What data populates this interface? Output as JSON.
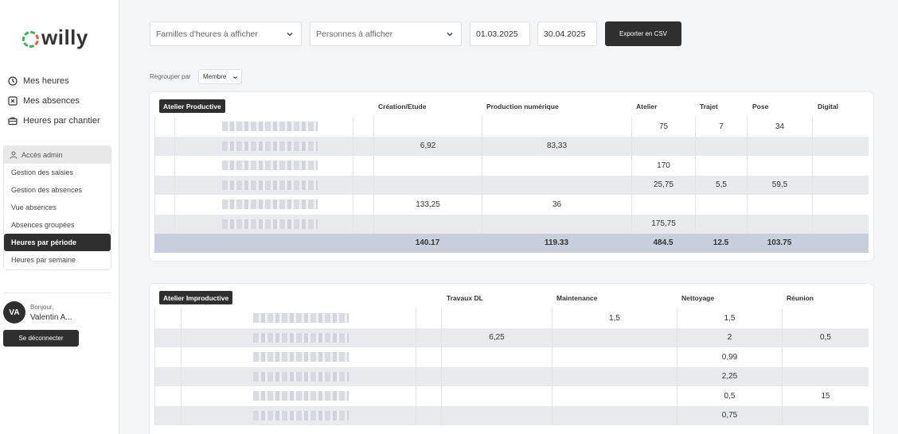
{
  "app": {
    "logo_text": "willy"
  },
  "sidebar": {
    "nav": [
      {
        "label": "Mes heures",
        "icon": "clock-icon"
      },
      {
        "label": "Mes absences",
        "icon": "x-square-icon"
      },
      {
        "label": "Heures par chantier",
        "icon": "briefcase-icon"
      }
    ],
    "admin_title": "Accès admin",
    "admin_items": [
      {
        "label": "Gestion des saisies"
      },
      {
        "label": "Gestion des absences"
      },
      {
        "label": "Vue absences"
      },
      {
        "label": "Absences groupées"
      },
      {
        "label": "Heures par période"
      },
      {
        "label": "Heures par semaine"
      }
    ],
    "user": {
      "initials": "VA",
      "greeting": "Bonjour,",
      "name": "Valentin A..."
    },
    "logout_label": "Se déconnecter"
  },
  "toolbar": {
    "families_placeholder": "Familles d'heures à afficher",
    "persons_placeholder": "Personnes à afficher",
    "date_from": "01.03.2025",
    "date_to": "30.04.2025",
    "export_label": "Exporter en CSV",
    "group_label": "Regrouper par",
    "group_value": "Membre"
  },
  "table1": {
    "tag": "Atelier Productive",
    "headers": [
      "Création/Etude",
      "Production numérique",
      "Atelier",
      "Trajet",
      "Pose",
      "Digital"
    ],
    "rows": [
      [
        "",
        "",
        "75",
        "7",
        "34",
        ""
      ],
      [
        "6,92",
        "83,33",
        "",
        "",
        "",
        ""
      ],
      [
        "",
        "",
        "170",
        "",
        "",
        ""
      ],
      [
        "",
        "",
        "25,75",
        "5,5",
        "59,5",
        ""
      ],
      [
        "133,25",
        "36",
        "",
        "",
        "",
        ""
      ],
      [
        "",
        "",
        "175,75",
        "",
        "",
        ""
      ]
    ],
    "totals": [
      "140.17",
      "119.33",
      "484.5",
      "12.5",
      "103.75",
      ""
    ]
  },
  "table2": {
    "tag": "Atelier Improductive",
    "headers": [
      "Travaux DL",
      "Maintenance",
      "Nettoyage",
      "Réunion"
    ],
    "rows": [
      [
        "",
        "1,5",
        "1,5",
        ""
      ],
      [
        "6,25",
        "",
        "2",
        "0,5"
      ],
      [
        "",
        "",
        "0,99",
        ""
      ],
      [
        "",
        "",
        "2,25",
        ""
      ],
      [
        "",
        "",
        "0,5",
        "15"
      ],
      [
        "",
        "",
        "0,75",
        ""
      ]
    ]
  }
}
